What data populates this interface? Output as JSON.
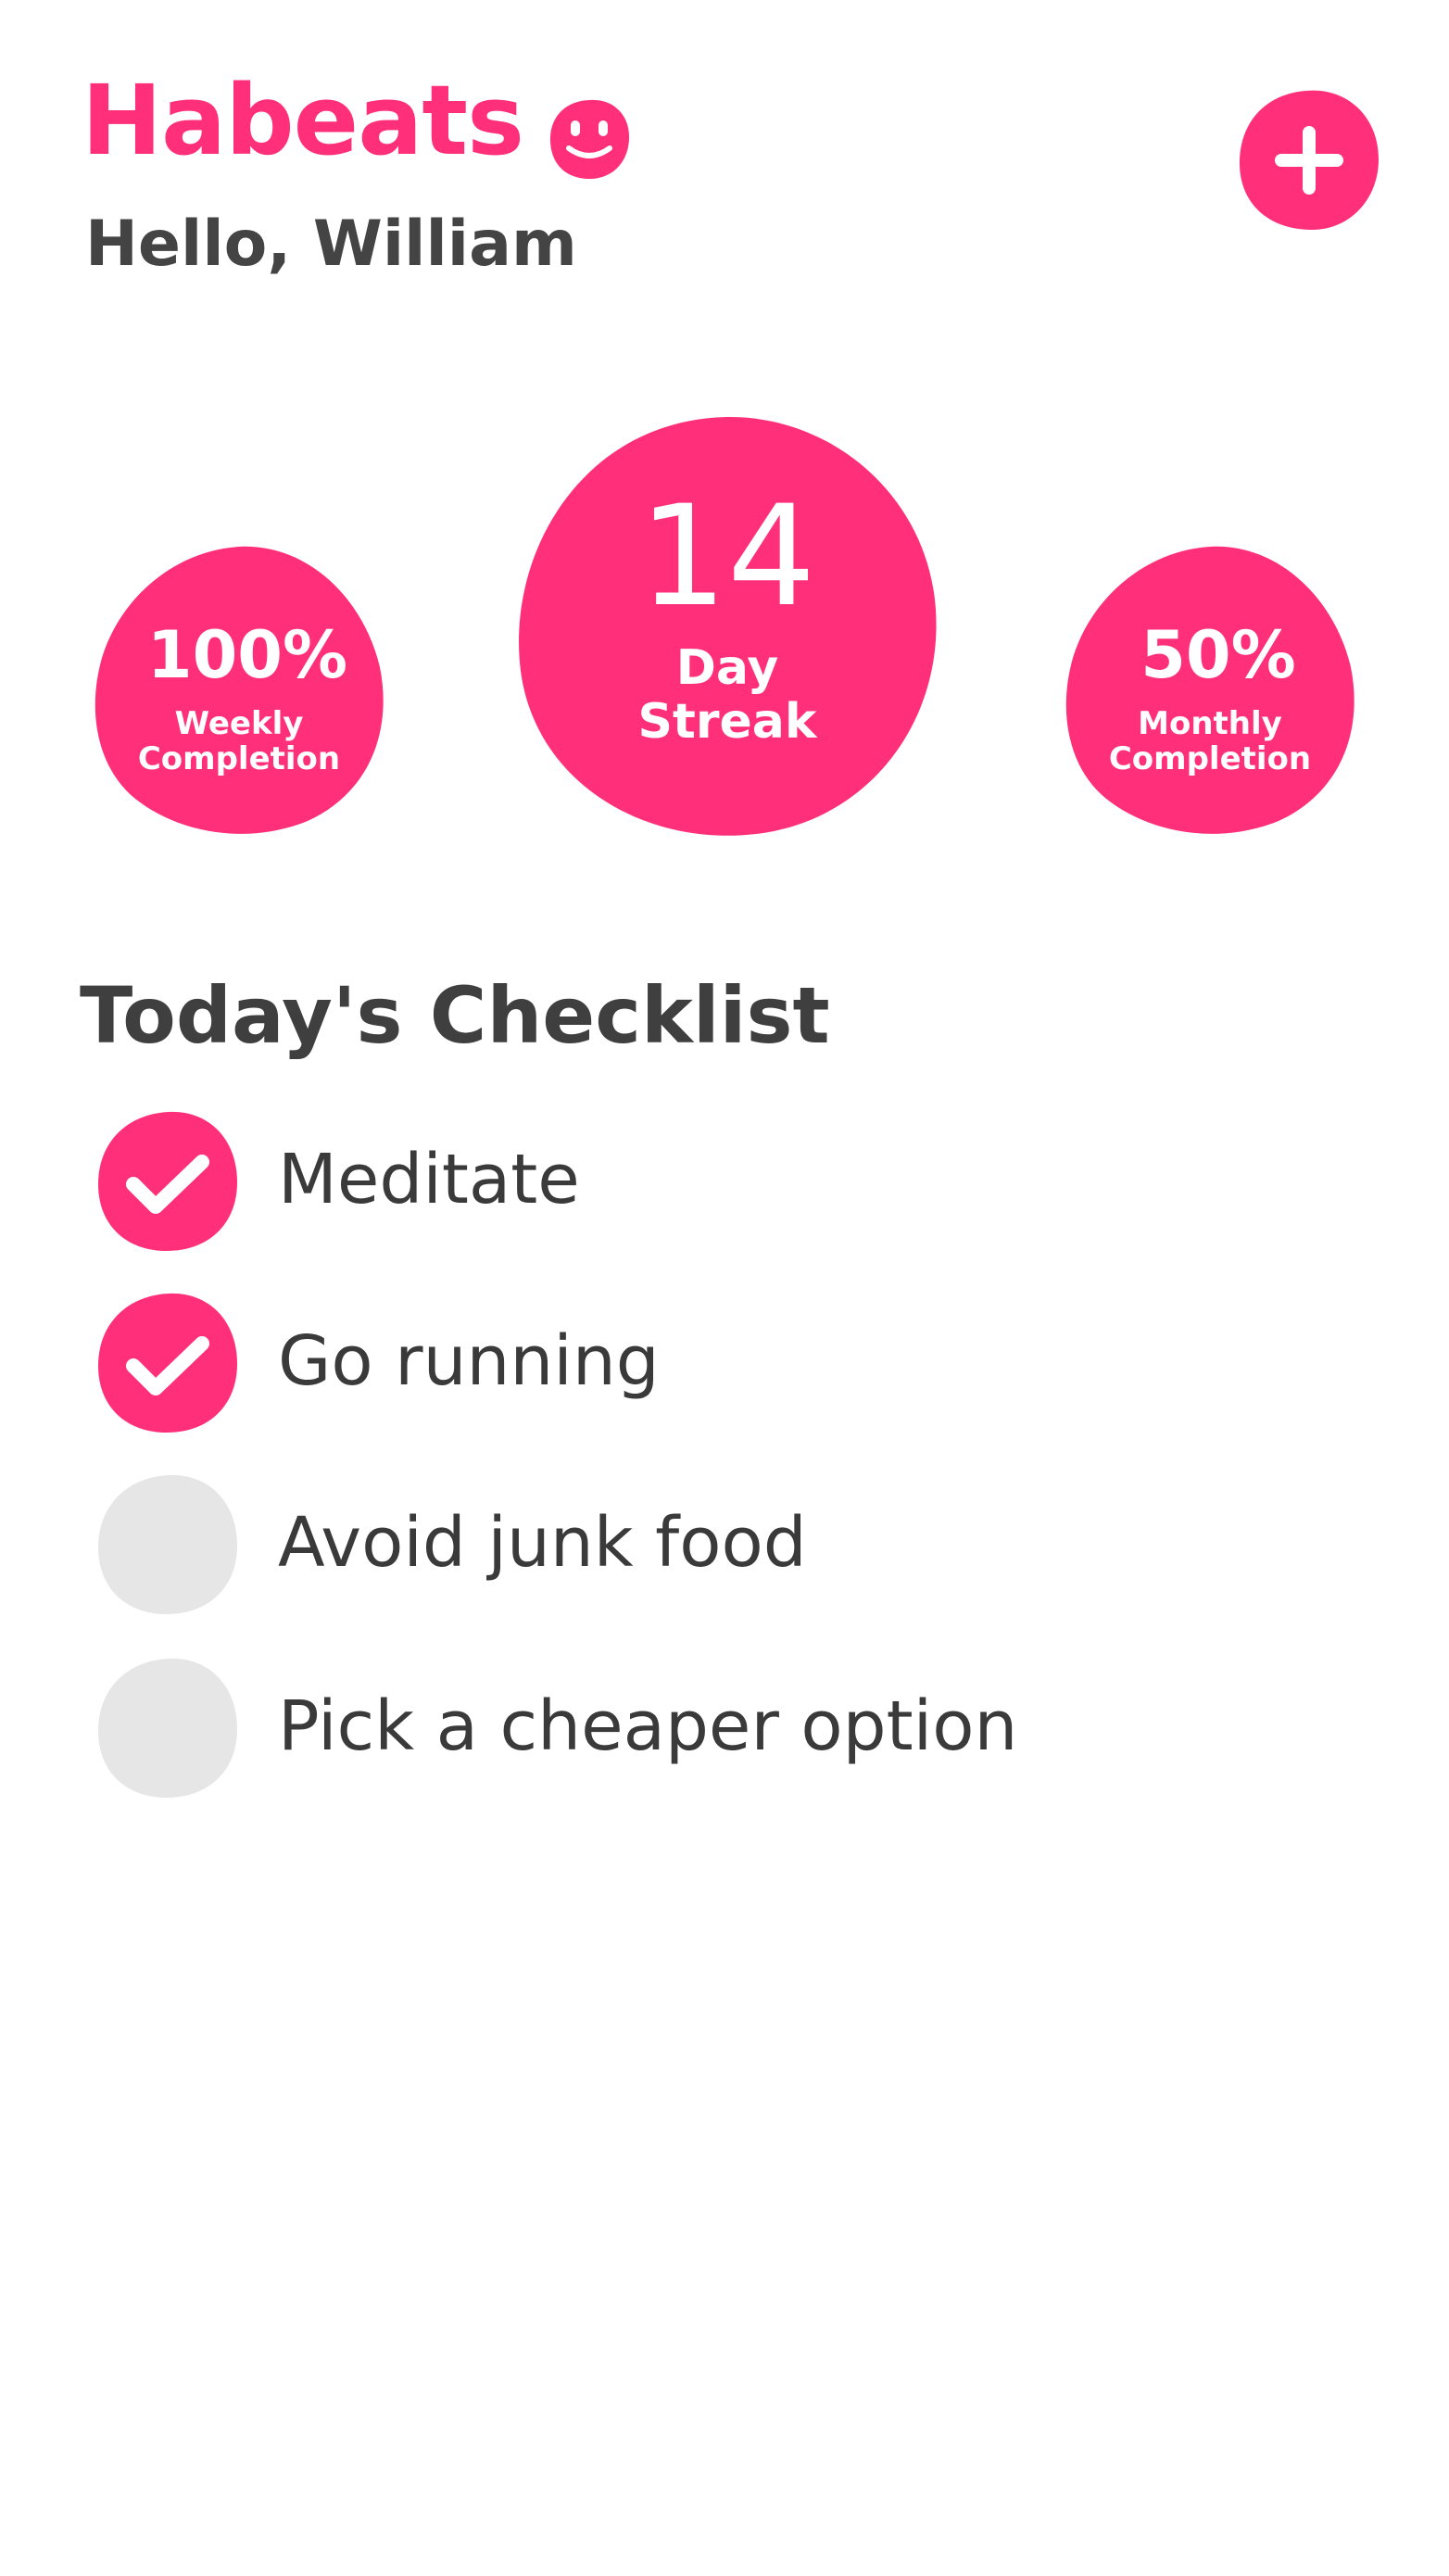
{
  "header": {
    "app_title": "Habeats",
    "greeting": "Hello, William",
    "logo_icon": "smiley-face-icon",
    "add_icon": "plus-icon"
  },
  "colors": {
    "accent": "#ff3079",
    "text_dark": "#3a3a3a",
    "unchecked": "#e6e6e6",
    "background": "#ffffff"
  },
  "stats": {
    "weekly": {
      "value": "100%",
      "label_line1": "Weekly",
      "label_line2": "Completion"
    },
    "streak": {
      "value": "14",
      "label_line1": "Day",
      "label_line2": "Streak"
    },
    "monthly": {
      "value": "50%",
      "label_line1": "Monthly",
      "label_line2": "Completion"
    }
  },
  "checklist": {
    "title": "Today's Checklist",
    "items": [
      {
        "label": "Meditate",
        "checked": true
      },
      {
        "label": "Go running",
        "checked": true
      },
      {
        "label": "Avoid junk food",
        "checked": false
      },
      {
        "label": "Pick a cheaper option",
        "checked": false
      }
    ]
  }
}
